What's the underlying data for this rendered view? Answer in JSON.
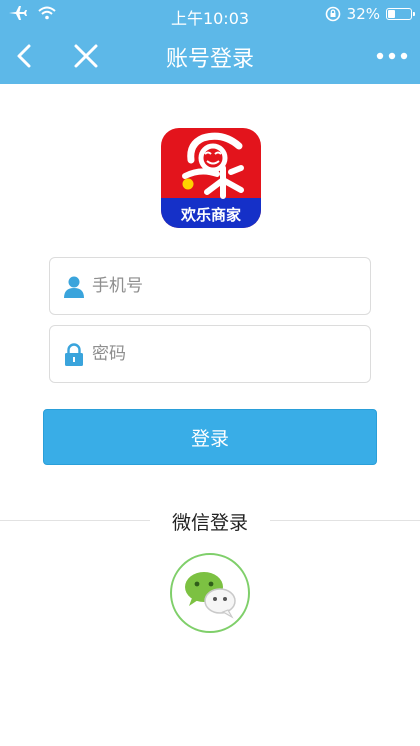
{
  "status_bar": {
    "time": "上午10:03",
    "battery_text": "32%",
    "battery_level": 0.32
  },
  "nav": {
    "title": "账号登录",
    "back_icon": "chevron-left-icon",
    "close_icon": "close-icon",
    "more_icon": "more-dots-icon"
  },
  "logo": {
    "name": "欢乐商家"
  },
  "form": {
    "phone_placeholder": "手机号",
    "phone_value": "",
    "password_placeholder": "密码",
    "password_value": "",
    "submit_label": "登录"
  },
  "wechat": {
    "label": "微信登录",
    "icon": "wechat-icon"
  },
  "colors": {
    "header_bg": "#5db8e8",
    "button_bg": "#39ade7",
    "logo_red": "#e3141c",
    "logo_blue": "#1530c8",
    "wechat_green": "#7fcf6a"
  }
}
